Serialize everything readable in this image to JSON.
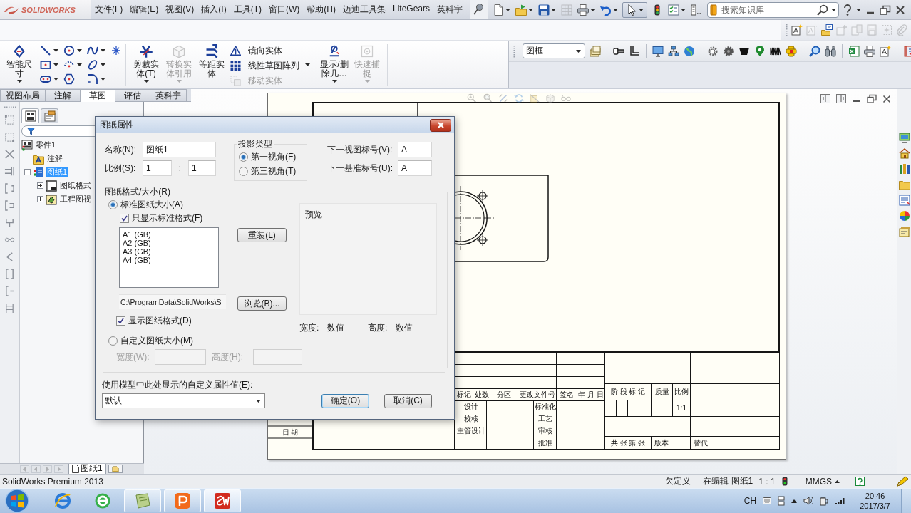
{
  "menubar": {
    "logo": "SOLIDWORKS",
    "menus": [
      "文件(F)",
      "编辑(E)",
      "视图(V)",
      "插入(I)",
      "工具(T)",
      "窗口(W)",
      "帮助(H)",
      "迈迪工具集",
      "LiteGears",
      "英科宇"
    ]
  },
  "quick_access": [
    {
      "disabled": false,
      "pressed": false
    },
    {
      "disabled": false,
      "pressed": false
    },
    {
      "disabled": false,
      "pressed": false
    },
    {
      "disabled": true,
      "pressed": false
    },
    {
      "disabled": false,
      "pressed": false
    },
    {
      "disabled": false,
      "pressed": false
    },
    {
      "disabled": false,
      "pressed": true
    },
    {
      "disabled": false,
      "pressed": false
    },
    {
      "disabled": false,
      "pressed": false
    },
    {
      "disabled": false,
      "pressed": false
    }
  ],
  "search": {
    "placeholder": "搜索知识库"
  },
  "annotation_tools": [
    {
      "disabled": false
    },
    {
      "disabled": true
    },
    {
      "disabled": false
    },
    {
      "disabled": true
    },
    {
      "disabled": true
    },
    {
      "disabled": true
    },
    {
      "disabled": true
    },
    {
      "disabled": true
    }
  ],
  "command_manager": {
    "commands": [
      {
        "kind": "large",
        "label": "智能尺寸",
        "disabled": false,
        "dropdown": true
      },
      {
        "kind": "sketch_tools"
      },
      {
        "kind": "large",
        "label": "剪裁实体(T)",
        "disabled": false,
        "dropdown": true
      },
      {
        "kind": "large",
        "label": "转换实体引用",
        "disabled": true,
        "dropdown": true
      },
      {
        "kind": "large",
        "label": "等距实体",
        "disabled": false,
        "dropdown": false
      },
      {
        "kind": "stack",
        "items": [
          {
            "label": "镜向实体",
            "disabled": false
          },
          {
            "label": "线性草图阵列",
            "disabled": false
          },
          {
            "label": "移动实体",
            "disabled": true
          }
        ]
      },
      {
        "kind": "large",
        "label": "显示/删除几…",
        "disabled": false,
        "dropdown": true
      },
      {
        "kind": "large",
        "label": "快速捕捉",
        "disabled": true,
        "dropdown": true
      }
    ],
    "tabs": [
      {
        "label": "视图布局",
        "selected": false
      },
      {
        "label": "注解",
        "selected": false
      },
      {
        "label": "草图",
        "selected": true
      },
      {
        "label": "评估",
        "selected": false
      },
      {
        "label": "英科宇",
        "selected": false
      }
    ]
  },
  "layer_select": {
    "value": "图框"
  },
  "feature_manager": {
    "panel_tabs": [
      {
        "selected": true
      },
      {
        "selected": false
      }
    ],
    "tree": [
      {
        "kind": "document",
        "label": "零件1",
        "selected": false,
        "children": [
          {
            "kind": "annotations",
            "label": "注解",
            "selected": false
          },
          {
            "kind": "sheet",
            "label": "图纸1",
            "selected": true,
            "expanded": true,
            "children": [
              {
                "kind": "sheet_format",
                "label": "图纸格式",
                "selected": false,
                "expanded": false
              },
              {
                "kind": "views",
                "label": "工程图视",
                "selected": false,
                "expanded": false
              }
            ]
          }
        ]
      }
    ]
  },
  "sheet_tabs": [
    {
      "label": "图纸1",
      "selected": true
    }
  ],
  "drawing": {
    "date_label": "日 期",
    "title_block": {
      "change_header": [
        "标记",
        "处数",
        "分区",
        "更改文件号",
        "签名",
        "年 月 日"
      ],
      "sign_rows": [
        {
          "role": "设计",
          "review": "标准化"
        },
        {
          "role": "校核",
          "review": "工艺"
        },
        {
          "role": "主管设计",
          "review": "审核"
        },
        {
          "review": "批准"
        }
      ],
      "stage_header": [
        "阶 段 标 记",
        "质量",
        "比例"
      ],
      "scale": "1:1",
      "sheet_count": "共 张 第 张",
      "version": "版本",
      "replaces": "替代"
    }
  },
  "dialog": {
    "title": "图纸属性",
    "name": {
      "label": "名称(N):",
      "value": "图纸1"
    },
    "scale": {
      "label": "比例(S):",
      "numerator": "1",
      "separator": ":",
      "denominator": "1"
    },
    "projection": {
      "label": "投影类型",
      "options": [
        {
          "label": "第一视角(F)",
          "selected": true
        },
        {
          "label": "第三视角(T)",
          "selected": false
        }
      ]
    },
    "next_view_label": {
      "label": "下一视图标号(V):",
      "value": "A"
    },
    "next_datum_label": {
      "label": "下一基准标号(U):",
      "value": "A"
    },
    "sheet_format": {
      "label": "图纸格式/大小(R)",
      "standard": {
        "label": "标准图纸大小(A)",
        "selected": true
      },
      "only_standard": {
        "label": "只显示标准格式(F)",
        "checked": true
      },
      "sizes": [
        {
          "label": "A1 (GB)",
          "selected": false
        },
        {
          "label": "A2 (GB)",
          "selected": false
        },
        {
          "label": "A3 (GB)",
          "selected": false
        },
        {
          "label": "A4 (GB)",
          "selected": false
        }
      ],
      "reload_button": "重装(L)",
      "path": "C:\\ProgramData\\SolidWorks\\S",
      "browse_button": "浏览(B)...",
      "show_format": {
        "label": "显示图纸格式(D)",
        "checked": true
      },
      "preview": {
        "label": "预览",
        "width_label": "宽度:",
        "width_value": "数值",
        "height_label": "高度:",
        "height_value": "数值"
      },
      "custom": {
        "label": "自定义图纸大小(M)",
        "selected": false
      },
      "custom_width": {
        "label": "宽度(W):",
        "disabled": true
      },
      "custom_height": {
        "label": "高度(H):",
        "disabled": true
      }
    },
    "property_source": {
      "label": "使用模型中此处显示的自定义属性值(E):",
      "value": "默认"
    },
    "buttons": [
      {
        "label": "确定(O)",
        "default": true
      },
      {
        "label": "取消(C)",
        "default": false
      }
    ]
  },
  "status_bar": {
    "product": "SolidWorks Premium 2013",
    "sketch_state": "欠定义",
    "editing": "在编辑 图纸1",
    "scale": "1 : 1",
    "units": "MMGS"
  },
  "taskbar": {
    "apps": [
      {
        "running": false,
        "active": false
      },
      {
        "running": false,
        "active": false
      },
      {
        "running": true,
        "active": false
      },
      {
        "running": true,
        "active": false
      },
      {
        "running": true,
        "active": true
      }
    ],
    "language": "CH",
    "time": "20:46",
    "date": "2017/3/7"
  }
}
